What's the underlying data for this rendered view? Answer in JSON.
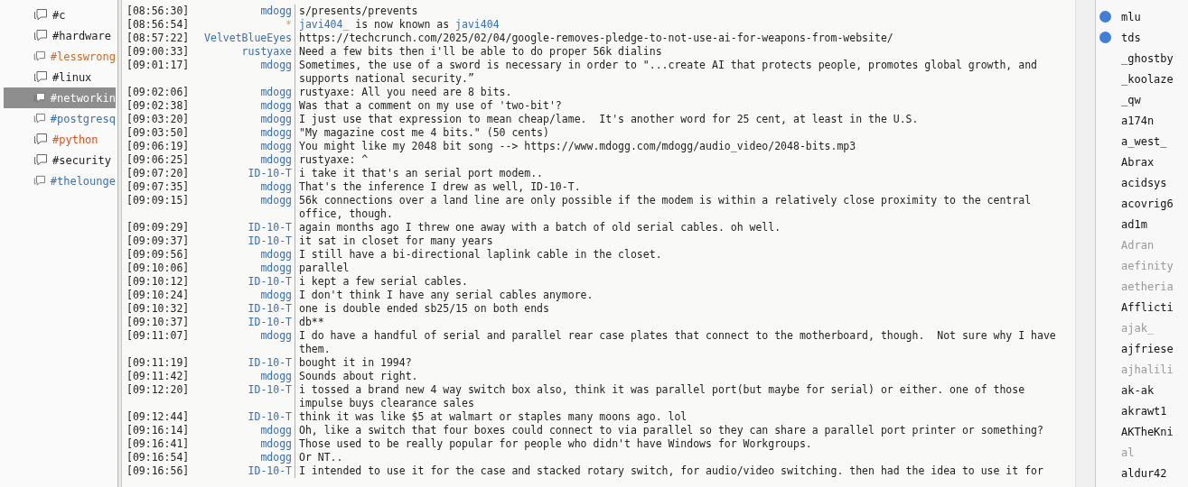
{
  "channels": [
    {
      "name": "#c",
      "color": "#222222",
      "selected": false
    },
    {
      "name": "#hardware",
      "color": "#222222",
      "selected": false
    },
    {
      "name": "#lesswrong",
      "color": "#d2691e",
      "selected": false
    },
    {
      "name": "#linux",
      "color": "#222222",
      "selected": false
    },
    {
      "name": "#networkin",
      "color": "#ffffff",
      "selected": true
    },
    {
      "name": "#postgresq",
      "color": "#3a6fb5",
      "selected": false
    },
    {
      "name": "#python",
      "color": "#e0521f",
      "selected": false
    },
    {
      "name": "#security",
      "color": "#222222",
      "selected": false
    },
    {
      "name": "#thelounge",
      "color": "#3a6fb5",
      "selected": false
    }
  ],
  "messages": [
    {
      "kind": "message",
      "time": "[08:56:30]",
      "nick": "mdogg",
      "text": "s/presents/prevents"
    },
    {
      "kind": "nick_change",
      "time": "[08:56:54]",
      "nick": "*",
      "old": "javi404_",
      "mid": " is now known as ",
      "new": "javi404"
    },
    {
      "kind": "message",
      "time": "[08:57:22]",
      "nick": "VelvetBlueEyes",
      "text": "https://techcrunch.com/2025/02/04/google-removes-pledge-to-not-use-ai-for-weapons-from-website/"
    },
    {
      "kind": "message",
      "time": "[09:00:33]",
      "nick": "rustyaxe",
      "text": "Need a few bits then i'll be able to do proper 56k dialins"
    },
    {
      "kind": "message",
      "time": "[09:01:17]",
      "nick": "mdogg",
      "text": "Sometimes, the use of a sword is necessary in order to \"...create AI that protects people, promotes global growth, and supports national security.”"
    },
    {
      "kind": "message",
      "time": "[09:02:06]",
      "nick": "mdogg",
      "text": "rustyaxe: All you need are 8 bits."
    },
    {
      "kind": "message",
      "time": "[09:02:38]",
      "nick": "mdogg",
      "text": "Was that a comment on my use of 'two-bit'?"
    },
    {
      "kind": "message",
      "time": "[09:03:20]",
      "nick": "mdogg",
      "text": "I just use that expression to mean cheap/lame.  It's another word for 25 cent, at least in the U.S."
    },
    {
      "kind": "message",
      "time": "[09:03:50]",
      "nick": "mdogg",
      "text": "\"My magazine cost me 4 bits.\" (50 cents)"
    },
    {
      "kind": "message",
      "time": "[09:06:19]",
      "nick": "mdogg",
      "text": "You might like my 2048 bit song --> https://www.mdogg.com/mdogg/audio_video/2048-bits.mp3"
    },
    {
      "kind": "message",
      "time": "[09:06:25]",
      "nick": "mdogg",
      "text": "rustyaxe: ^"
    },
    {
      "kind": "message",
      "time": "[09:07:20]",
      "nick": "ID-10-T",
      "text": "i take it that's an serial port modem.."
    },
    {
      "kind": "message",
      "time": "[09:07:35]",
      "nick": "mdogg",
      "text": "That's the inference I drew as well, ID-10-T."
    },
    {
      "kind": "message",
      "time": "[09:09:15]",
      "nick": "mdogg",
      "text": "56k connections over a land line are only possible if the modem is within a relatively close proximity to the central office, though."
    },
    {
      "kind": "message",
      "time": "[09:09:29]",
      "nick": "ID-10-T",
      "text": "again months ago I threw one away with a batch of old serial cables. oh well."
    },
    {
      "kind": "message",
      "time": "[09:09:37]",
      "nick": "ID-10-T",
      "text": "it sat in closet for many years"
    },
    {
      "kind": "message",
      "time": "[09:09:56]",
      "nick": "mdogg",
      "text": "I still have a bi-directional laplink cable in the closet."
    },
    {
      "kind": "message",
      "time": "[09:10:06]",
      "nick": "mdogg",
      "text": "parallel"
    },
    {
      "kind": "message",
      "time": "[09:10:12]",
      "nick": "ID-10-T",
      "text": "i kept a few serial cables."
    },
    {
      "kind": "message",
      "time": "[09:10:24]",
      "nick": "mdogg",
      "text": "I don't think I have any serial cables anymore."
    },
    {
      "kind": "message",
      "time": "[09:10:32]",
      "nick": "ID-10-T",
      "text": "one is double ended sb25/15 on both ends"
    },
    {
      "kind": "message",
      "time": "[09:10:37]",
      "nick": "ID-10-T",
      "text": "db**"
    },
    {
      "kind": "message",
      "time": "[09:11:07]",
      "nick": "mdogg",
      "text": "I do have a handful of serial and parallel rear case plates that connect to the motherboard, though.  Not sure why I have them."
    },
    {
      "kind": "message",
      "time": "[09:11:19]",
      "nick": "ID-10-T",
      "text": "bought it in 1994?"
    },
    {
      "kind": "message",
      "time": "[09:11:42]",
      "nick": "mdogg",
      "text": "Sounds about right."
    },
    {
      "kind": "message",
      "time": "[09:12:20]",
      "nick": "ID-10-T",
      "text": "i tossed a brand new 4 way switch box also, think it was parallel port(but maybe for serial) or either. one of those impulse buys clearance sales"
    },
    {
      "kind": "message",
      "time": "[09:12:44]",
      "nick": "ID-10-T",
      "text": "think it was like $5 at walmart or staples many moons ago. lol"
    },
    {
      "kind": "message",
      "time": "[09:16:14]",
      "nick": "mdogg",
      "text": "Oh, like a switch that four boxes could connect to via parallel so they can share a parallel port printer or something?"
    },
    {
      "kind": "message",
      "time": "[09:16:41]",
      "nick": "mdogg",
      "text": "Those used to be really popular for people who didn't have Windows for Workgroups."
    },
    {
      "kind": "message",
      "time": "[09:16:54]",
      "nick": "mdogg",
      "text": "Or NT.."
    },
    {
      "kind": "message",
      "time": "[09:16:56]",
      "nick": "ID-10-T",
      "text": "I intended to use it for the case and stacked rotary switch, for audio/video switching. then had the idea to use it for"
    }
  ],
  "users": [
    {
      "name": "mlu",
      "op": true,
      "away": false
    },
    {
      "name": "tds",
      "op": true,
      "away": false
    },
    {
      "name": "_ghostby",
      "op": false,
      "away": false
    },
    {
      "name": "_koolaze",
      "op": false,
      "away": false
    },
    {
      "name": "_qw",
      "op": false,
      "away": false
    },
    {
      "name": "a174n",
      "op": false,
      "away": false
    },
    {
      "name": "a_west_",
      "op": false,
      "away": false
    },
    {
      "name": "Abrax",
      "op": false,
      "away": false
    },
    {
      "name": "acidsys",
      "op": false,
      "away": false
    },
    {
      "name": "acovrig6",
      "op": false,
      "away": false
    },
    {
      "name": "ad1m",
      "op": false,
      "away": false
    },
    {
      "name": "Adran",
      "op": false,
      "away": true
    },
    {
      "name": "aefinity",
      "op": false,
      "away": true
    },
    {
      "name": "aetheria",
      "op": false,
      "away": true
    },
    {
      "name": "Afflicti",
      "op": false,
      "away": false
    },
    {
      "name": "ajak_",
      "op": false,
      "away": true
    },
    {
      "name": "ajfriese",
      "op": false,
      "away": false
    },
    {
      "name": "ajhalili",
      "op": false,
      "away": true
    },
    {
      "name": "ak-ak",
      "op": false,
      "away": false
    },
    {
      "name": "akrawt1",
      "op": false,
      "away": false
    },
    {
      "name": "AKTheKni",
      "op": false,
      "away": false
    },
    {
      "name": "al",
      "op": false,
      "away": true
    },
    {
      "name": "aldur42",
      "op": false,
      "away": false
    }
  ]
}
